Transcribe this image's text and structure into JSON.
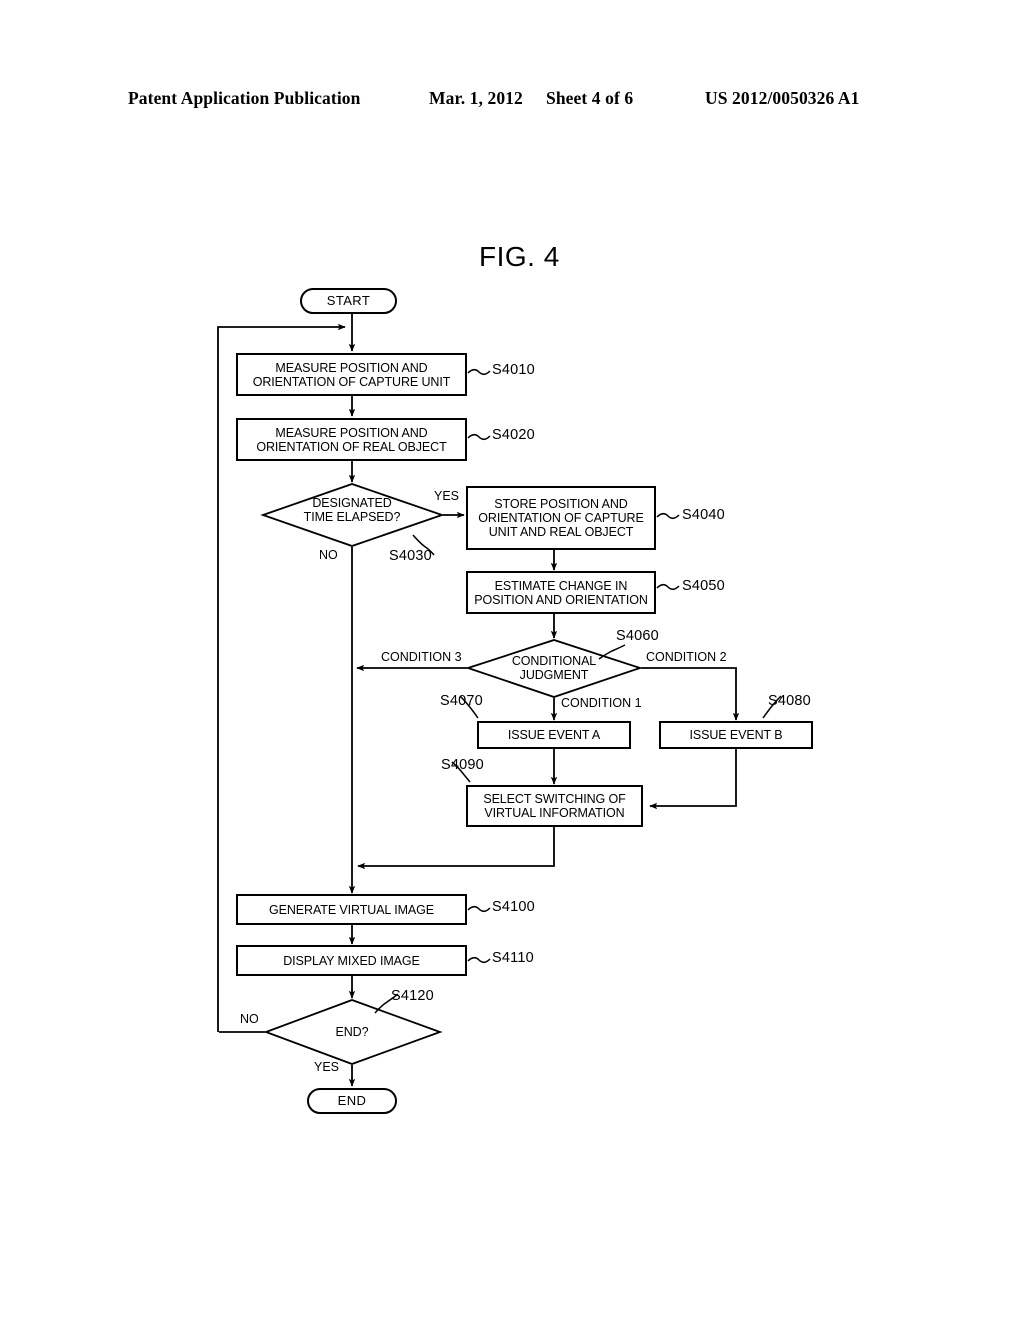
{
  "header": {
    "publication": "Patent Application Publication",
    "date": "Mar. 1, 2012",
    "sheet": "Sheet 4 of 6",
    "number": "US 2012/0050326 A1"
  },
  "figure": {
    "title": "FIG. 4",
    "type": "flowchart"
  },
  "nodes": {
    "start": {
      "label": "START",
      "shape": "terminator"
    },
    "s4010": {
      "label": "MEASURE POSITION AND\nORIENTATION OF CAPTURE UNIT",
      "ref": "S4010",
      "shape": "process"
    },
    "s4020": {
      "label": "MEASURE POSITION AND\nORIENTATION OF REAL OBJECT",
      "ref": "S4020",
      "shape": "process"
    },
    "s4030": {
      "label": "DESIGNATED\nTIME ELAPSED?",
      "ref": "S4030",
      "shape": "decision"
    },
    "s4040": {
      "label": "STORE POSITION AND\nORIENTATION OF CAPTURE\nUNIT AND REAL OBJECT",
      "ref": "S4040",
      "shape": "process"
    },
    "s4050": {
      "label": "ESTIMATE CHANGE IN\nPOSITION AND ORIENTATION",
      "ref": "S4050",
      "shape": "process"
    },
    "s4060": {
      "label": "CONDITIONAL\nJUDGMENT",
      "ref": "S4060",
      "shape": "decision"
    },
    "s4070": {
      "label": "ISSUE EVENT A",
      "ref": "S4070",
      "shape": "process"
    },
    "s4080": {
      "label": "ISSUE EVENT B",
      "ref": "S4080",
      "shape": "process"
    },
    "s4090": {
      "label": "SELECT SWITCHING OF\nVIRTUAL INFORMATION",
      "ref": "S4090",
      "shape": "process"
    },
    "s4100": {
      "label": "GENERATE VIRTUAL IMAGE",
      "ref": "S4100",
      "shape": "process"
    },
    "s4110": {
      "label": "DISPLAY MIXED IMAGE",
      "ref": "S4110",
      "shape": "process"
    },
    "s4120": {
      "label": "END?",
      "ref": "S4120",
      "shape": "decision"
    },
    "end": {
      "label": "END",
      "shape": "terminator"
    }
  },
  "edge_labels": {
    "yes_s4030": "YES",
    "no_s4030": "NO",
    "condition1": "CONDITION 1",
    "condition2": "CONDITION 2",
    "condition3": "CONDITION 3",
    "no_s4120": "NO",
    "yes_s4120": "YES"
  }
}
